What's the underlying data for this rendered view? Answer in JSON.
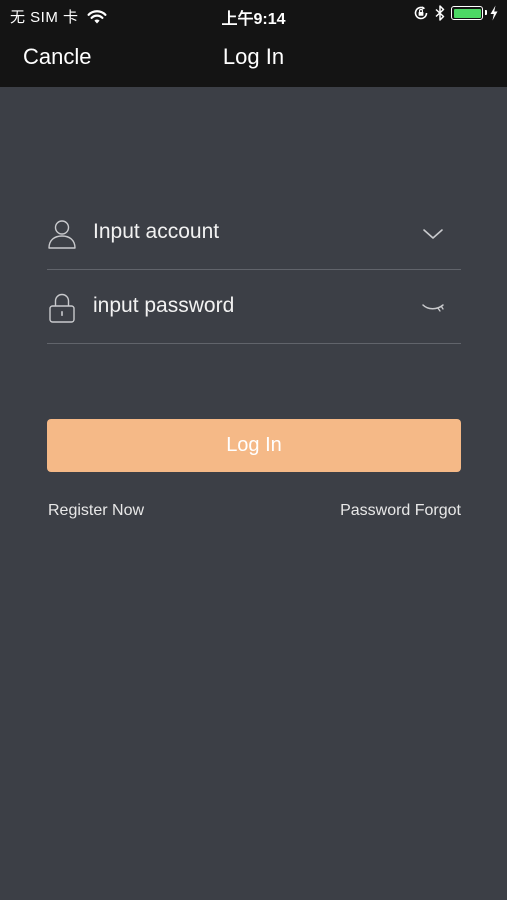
{
  "status_bar": {
    "carrier": "无 SIM 卡",
    "time": "上午9:14",
    "battery_level": 1.0
  },
  "nav": {
    "cancel_label": "Cancle",
    "title": "Log In"
  },
  "form": {
    "account_placeholder": "Input account",
    "password_placeholder": "input password",
    "login_button": "Log In"
  },
  "links": {
    "register": "Register Now",
    "forgot": "Password Forgot"
  },
  "colors": {
    "background": "#3c3f46",
    "bar": "#141414",
    "button": "#f5b987",
    "battery": "#4cd964"
  },
  "icons": {
    "wifi": "wifi-icon",
    "orientation_lock": "orientation-lock-icon",
    "bluetooth": "bluetooth-icon",
    "battery": "battery-icon",
    "charging": "charging-bolt-icon",
    "user": "user-icon",
    "lock": "lock-icon",
    "dropdown": "chevron-down-icon",
    "hidden_password": "eye-closed-icon"
  }
}
